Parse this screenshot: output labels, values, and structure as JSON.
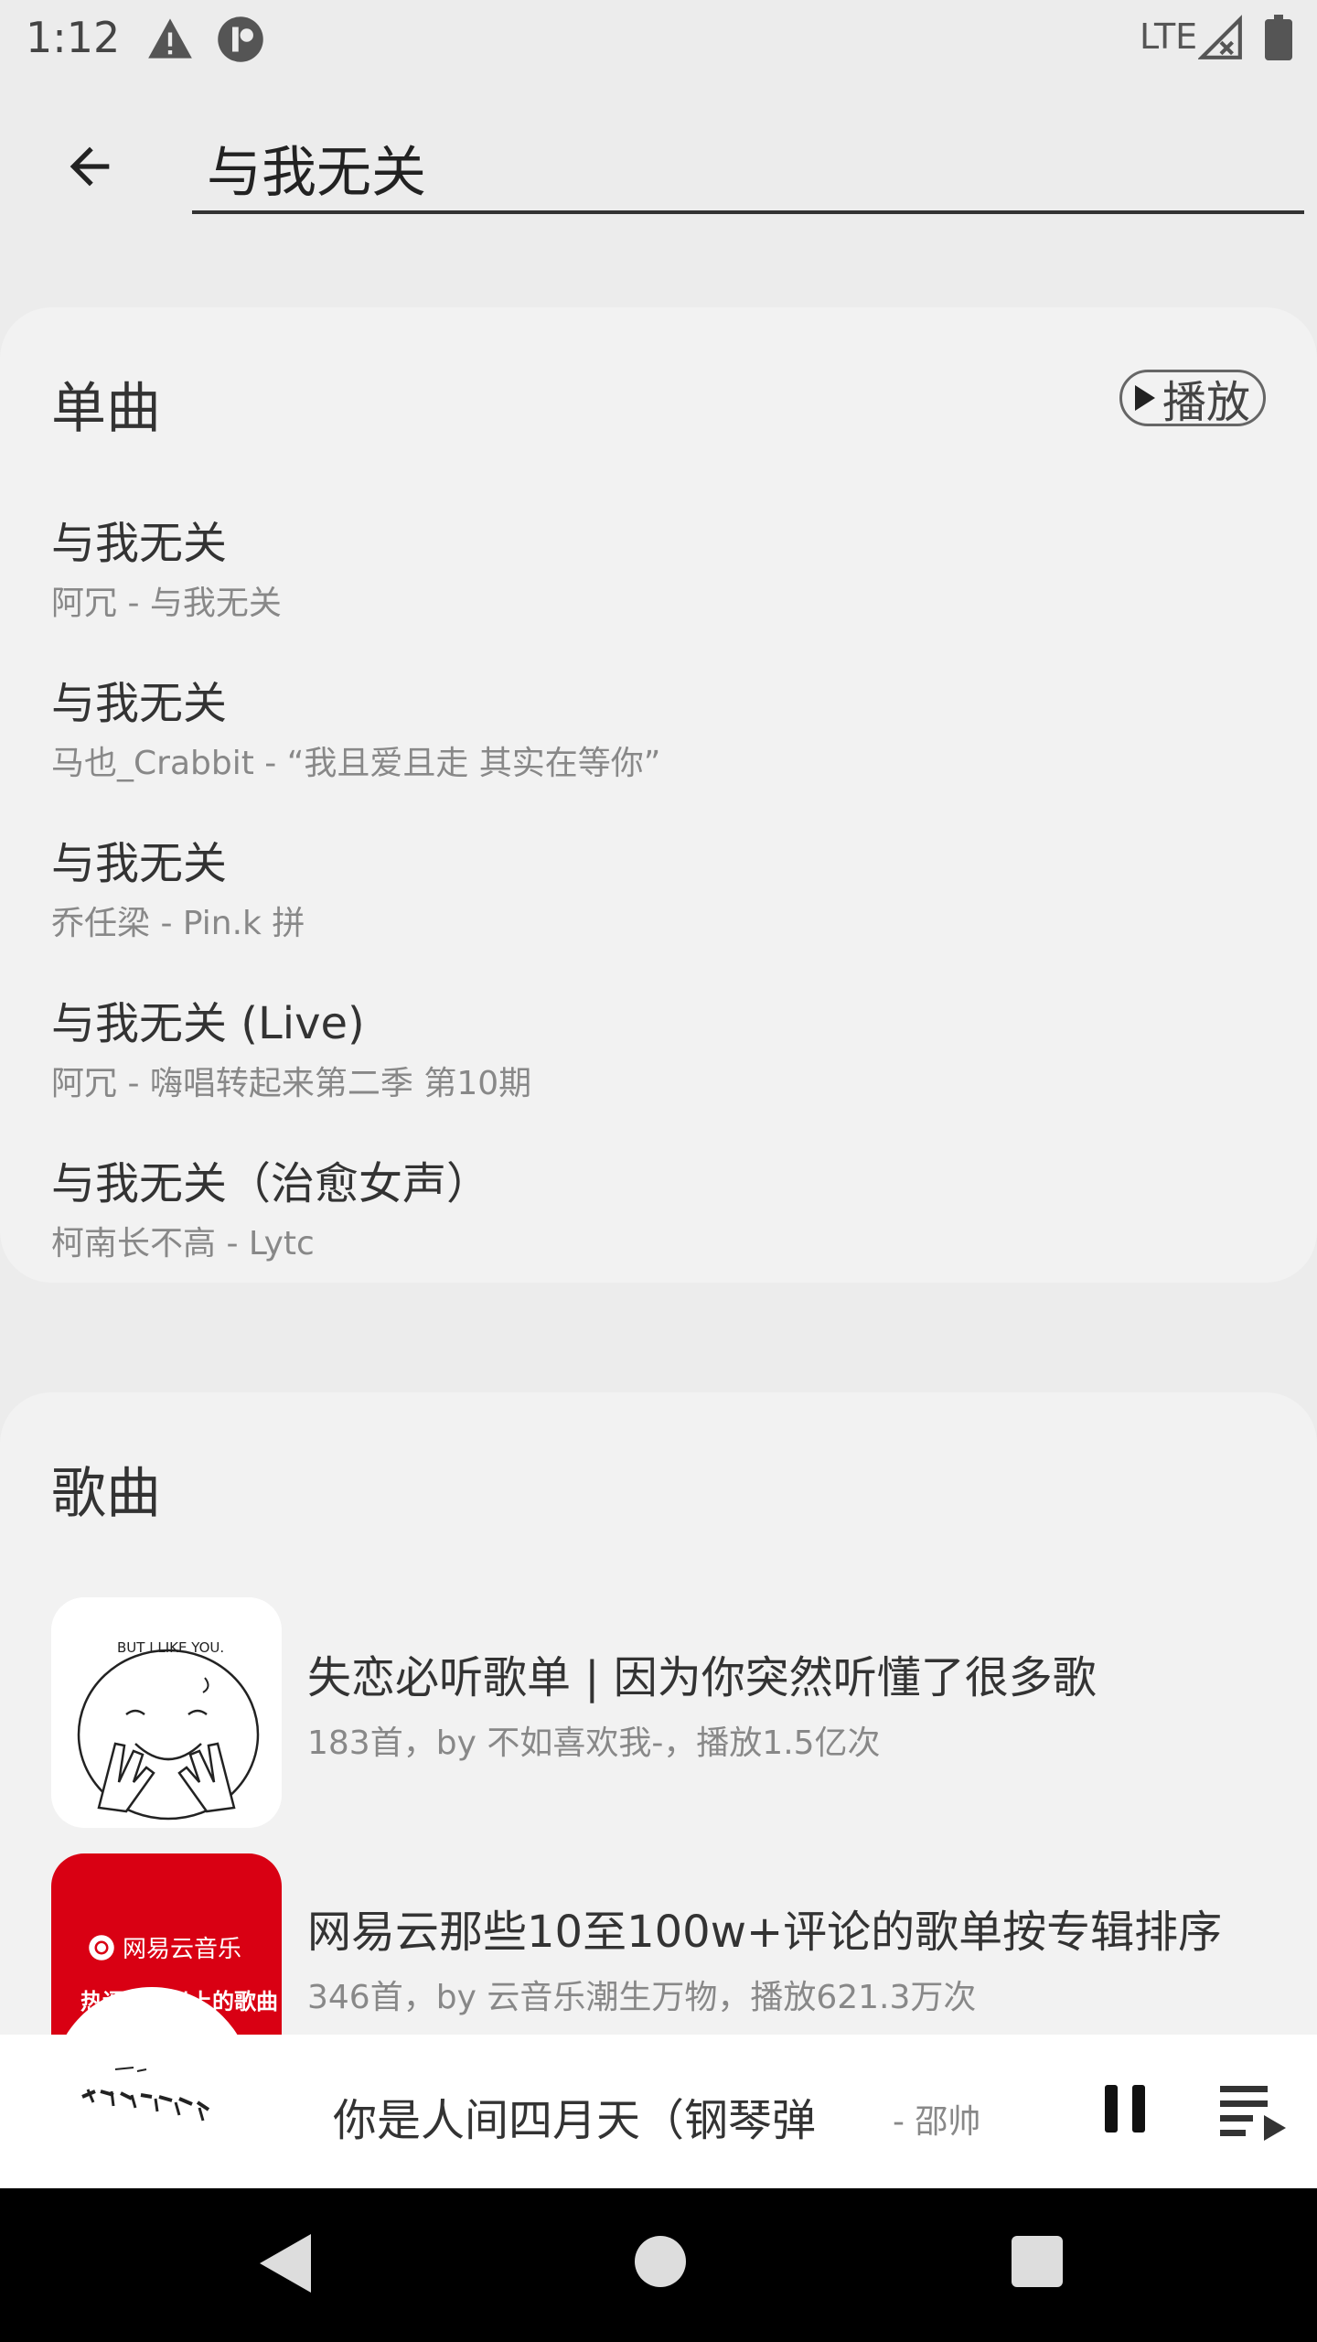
{
  "status_bar": {
    "time": "1:12",
    "network": "LTE"
  },
  "search": {
    "query": "与我无关"
  },
  "singles": {
    "section_title": "单曲",
    "play_label": "播放",
    "items": [
      {
        "title": "与我无关",
        "subtitle": "阿冗 - 与我无关"
      },
      {
        "title": "与我无关",
        "subtitle": "马也_Crabbit - “我且爱且走 其实在等你”"
      },
      {
        "title": "与我无关",
        "subtitle": "乔任梁 - Pin.k 拼"
      },
      {
        "title": "与我无关 (Live)",
        "subtitle": "阿冗 - 嗨唱转起来第二季 第10期"
      },
      {
        "title": "与我无关（治愈女声）",
        "subtitle": "柯南长不高 - Lytc"
      }
    ]
  },
  "songs": {
    "section_title": "歌曲",
    "playlists": [
      {
        "title": "失恋必听歌单 | 因为你突然听懂了很多歌",
        "subtitle": "183首，by 不如喜欢我-，播放1.5亿次",
        "cover_text": "BUT I LIKE YOU."
      },
      {
        "title": "网易云那些10至100w+评论的歌单按专辑排序",
        "subtitle": "346首，by 云音乐潮生万物，播放621.3万次",
        "cover_brand": "网易云音乐",
        "cover_text": "热评十万以上的歌曲"
      }
    ]
  },
  "player": {
    "title": "你是人间四月天（钢琴弹",
    "artist": "- 邵帅"
  },
  "colors": {
    "brand_red": "#d90013"
  }
}
